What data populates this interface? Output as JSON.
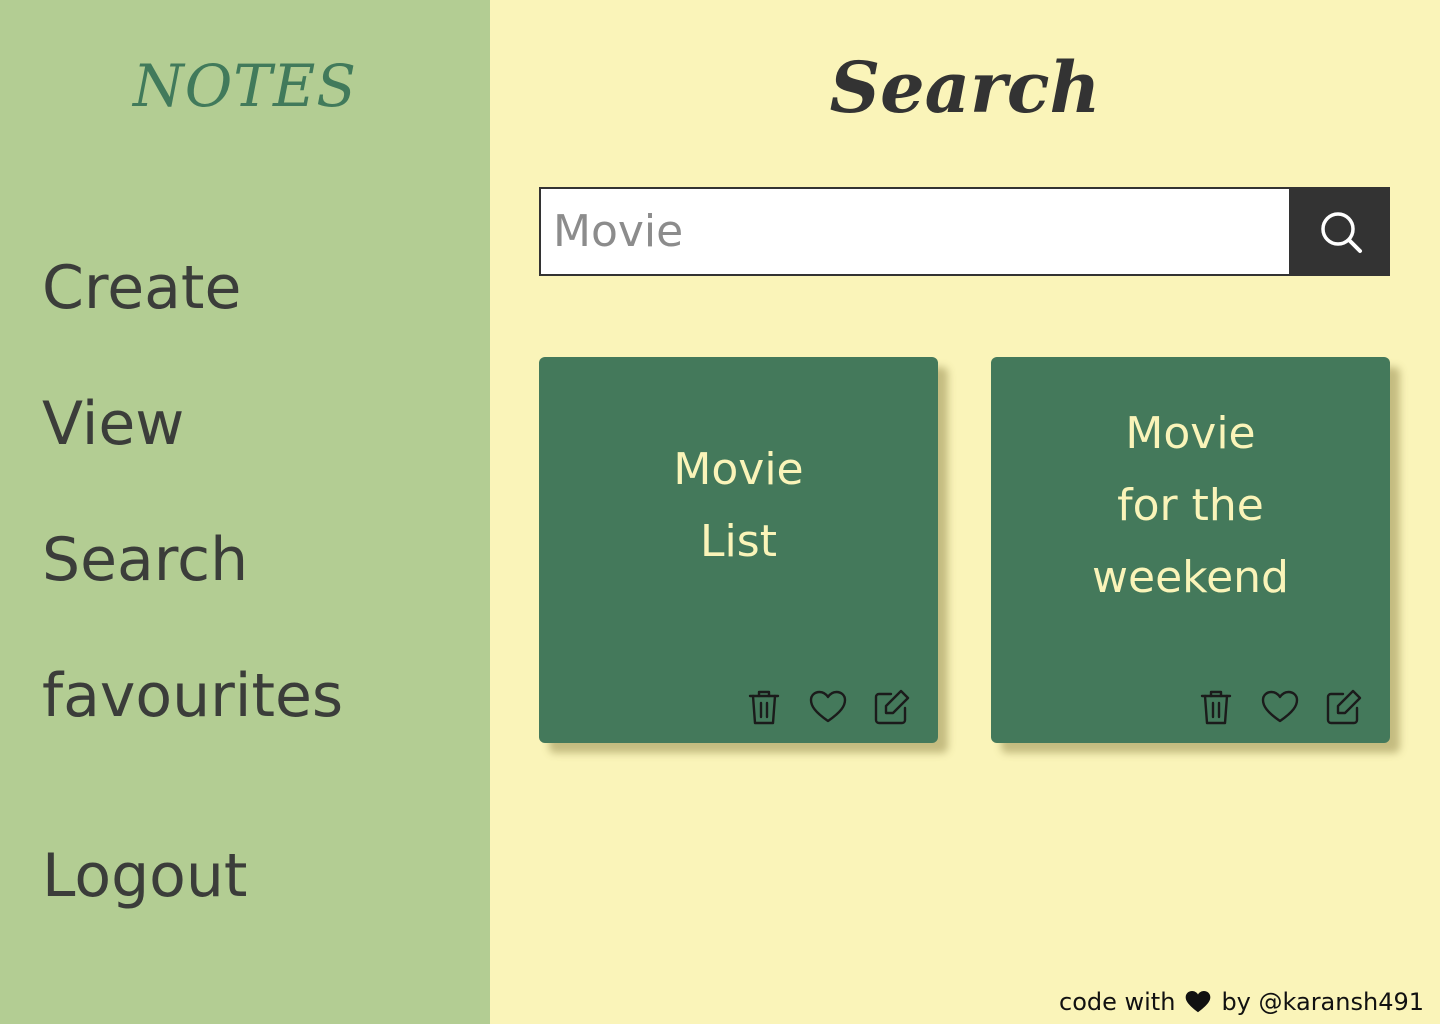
{
  "sidebar": {
    "brand": "NOTES",
    "items": [
      {
        "label": "Create"
      },
      {
        "label": "View"
      },
      {
        "label": "Search"
      },
      {
        "label": "favourites"
      }
    ],
    "logout_label": "Logout"
  },
  "main": {
    "title": "Search",
    "search": {
      "value": "",
      "placeholder": "Movie",
      "button_icon": "search-icon"
    },
    "cards": [
      {
        "title": "Movie\nList",
        "actions": [
          "trash-icon",
          "heart-icon",
          "edit-icon"
        ]
      },
      {
        "title": "Movie\nfor the\nweekend",
        "actions": [
          "trash-icon",
          "heart-icon",
          "edit-icon"
        ]
      }
    ]
  },
  "footer": {
    "prefix": "code with",
    "icon": "heart-filled-icon",
    "suffix": "by @karansh491"
  },
  "colors": {
    "sidebar_bg": "#b3cd93",
    "main_bg": "#faf4b9",
    "card_bg": "#44795b",
    "brand": "#417a5b",
    "text_dark": "#3b3d3a",
    "search_button": "#333333"
  }
}
